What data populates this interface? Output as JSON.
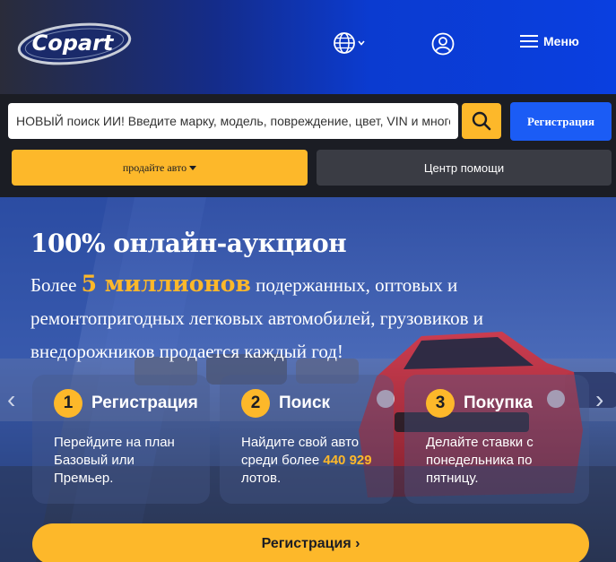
{
  "header": {
    "logo_text": "Copart",
    "menu_label": "Меню",
    "icons": [
      "globe-icon",
      "chevron-down-icon",
      "user-icon",
      "hamburger-icon"
    ]
  },
  "search": {
    "placeholder": "НОВЫЙ поиск ИИ! Введите марку, модель, повреждение, цвет, VIN и многое другое",
    "register_label": "Регистрация",
    "sell_label": "продайте авто",
    "help_label": "Центр помощи"
  },
  "hero": {
    "title": "100% онлайн-аукцион",
    "text_before": "Более ",
    "text_highlight": "5 миллионов",
    "text_after": " подержанных, оптовых и ремонтопригодных легковых автомобилей, грузовиков и внедорожников продается каждый год!",
    "arrow_left": "‹",
    "arrow_right": "›",
    "steps": [
      {
        "num": "1",
        "title": "Регистрация",
        "desc": "Перейдите на план Базовый или Премьер."
      },
      {
        "num": "2",
        "title": "Поиск",
        "desc_before": "Найдите свой авто среди более ",
        "desc_highlight": "440 929",
        "desc_after": " лотов."
      },
      {
        "num": "3",
        "title": "Покупка",
        "desc": "Делайте ставки с понедельника по пятницу."
      }
    ],
    "cta_label": "Регистрация ›"
  },
  "colors": {
    "accent_yellow": "#fdb82a",
    "brand_blue": "#1b5cf5",
    "dark": "#1b1d24"
  }
}
